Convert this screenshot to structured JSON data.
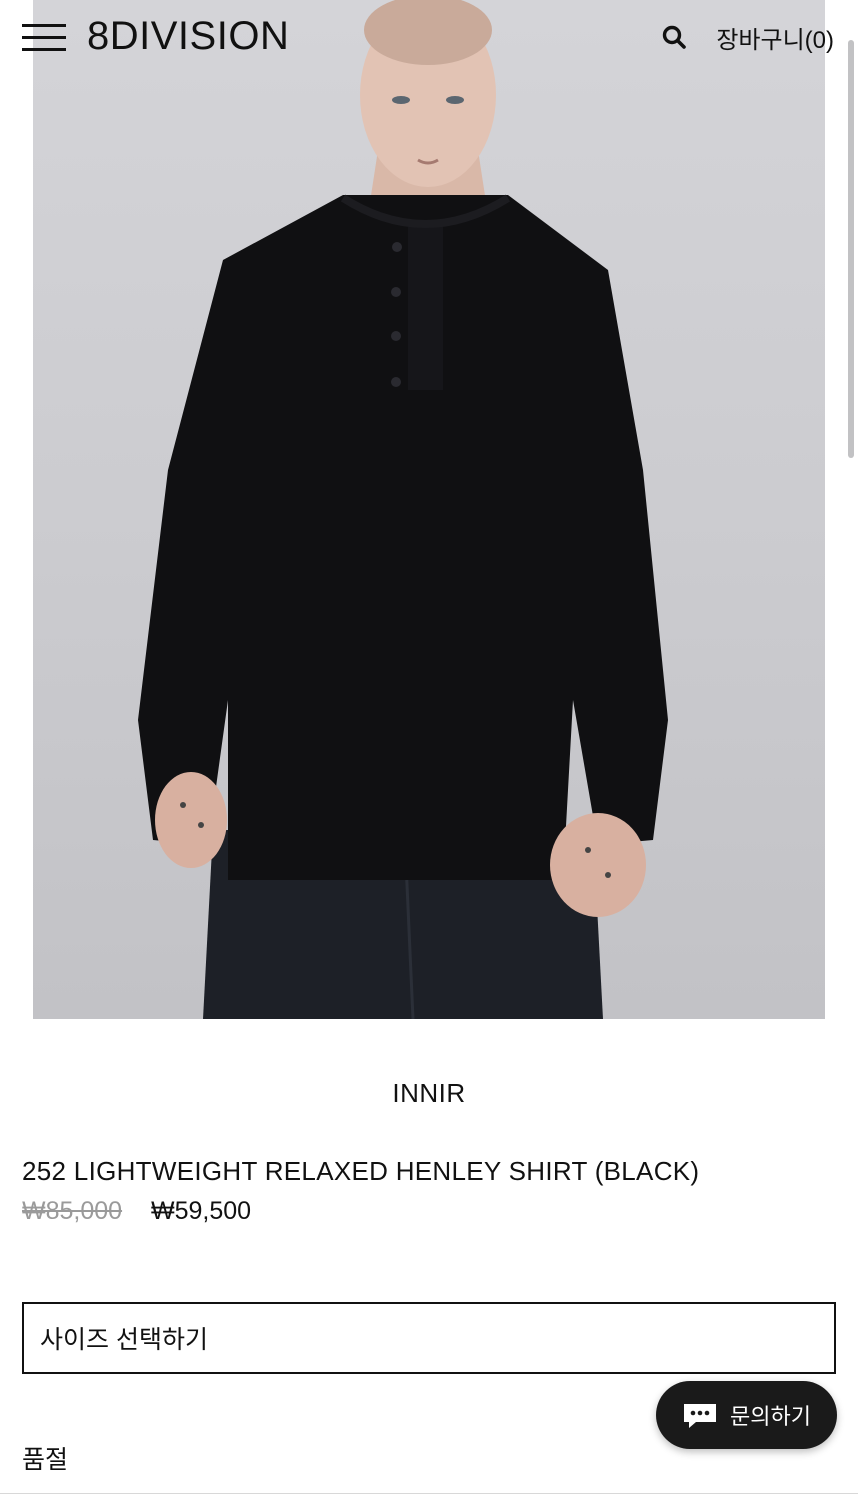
{
  "header": {
    "logo": "8DIVISION",
    "cart_label": "장바구니(0)"
  },
  "product": {
    "brand": "INNIR",
    "name": "252 LIGHTWEIGHT RELAXED HENLEY SHIRT (BLACK)",
    "price_original": "₩85,000",
    "price_sale": "₩59,500",
    "size_select_placeholder": "사이즈 선택하기",
    "soldout_label": "품절"
  },
  "chat": {
    "label": "문의하기"
  },
  "icons": {
    "menu": "hamburger-menu-icon",
    "search": "search-icon",
    "chat": "chat-bubble-icon"
  },
  "colors": {
    "text": "#111111",
    "price_original": "#9a9a9a",
    "chat_button": "#1a1a1a",
    "hero_background": "#d0d0d4"
  }
}
